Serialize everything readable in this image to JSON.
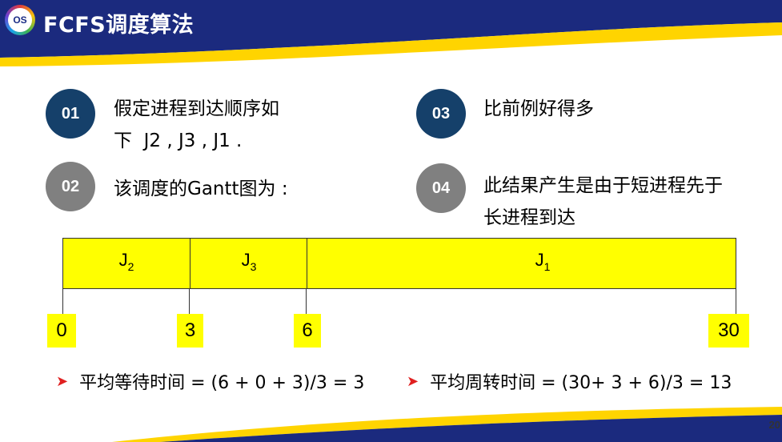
{
  "header": {
    "logo_text": "OS",
    "title": "FCFS调度算法"
  },
  "items": [
    {
      "num": "01",
      "line1": "假定进程到达顺序如",
      "line2": "下  J2 , J3 , J1 ."
    },
    {
      "num": "02",
      "line1": "该调度的Gantt图为 :",
      "line2": ""
    },
    {
      "num": "03",
      "line1": "比前例好得多",
      "line2": ""
    },
    {
      "num": "04",
      "line1": "此结果产生是由于短进程先于",
      "line2": "长进程到达"
    }
  ],
  "gantt": {
    "segments": [
      {
        "job": "J",
        "sub": "2",
        "start": 0,
        "end": 3
      },
      {
        "job": "J",
        "sub": "3",
        "start": 3,
        "end": 6
      },
      {
        "job": "J",
        "sub": "1",
        "start": 6,
        "end": 30
      }
    ],
    "ticks": [
      "0",
      "3",
      "6",
      "30"
    ]
  },
  "bullets": [
    "平均等待时间 = (6 + 0 + 3)/3 = 3",
    "平均周转时间 = (30+ 3 + 6)/3 = 13"
  ],
  "page_number": "20",
  "colors": {
    "header_navy": "#1b2a7e",
    "accent_yellow": "#ffd400",
    "gantt_fill": "#ffff00",
    "circle_dark": "#15406a",
    "circle_grey": "#808080",
    "bullet_arrow": "#e02020"
  }
}
